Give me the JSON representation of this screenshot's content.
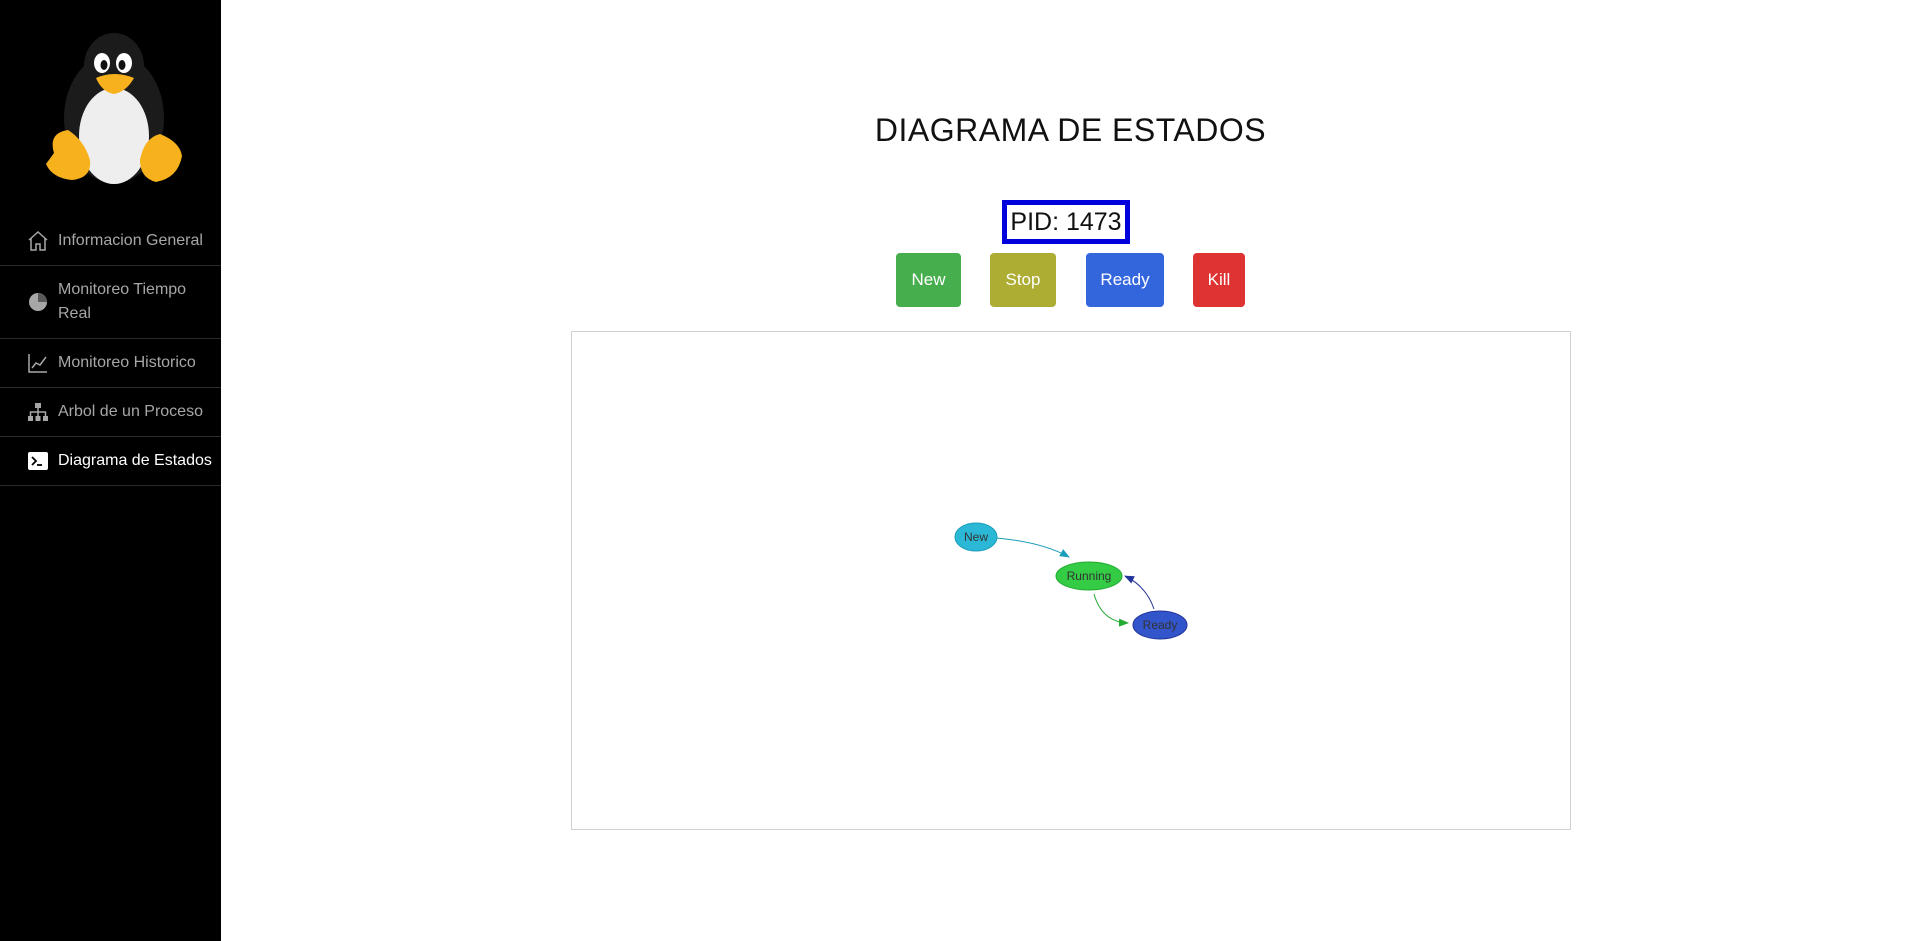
{
  "sidebar": {
    "logo": "tux-penguin-logo",
    "items": [
      {
        "label": "Informacion General",
        "icon": "home-icon",
        "active": false
      },
      {
        "label": "Monitoreo Tiempo Real",
        "icon": "pie-chart-icon",
        "active": false
      },
      {
        "label": "Monitoreo Historico",
        "icon": "line-chart-icon",
        "active": false
      },
      {
        "label": "Arbol de un Proceso",
        "icon": "sitemap-icon",
        "active": false
      },
      {
        "label": "Diagrama de Estados",
        "icon": "terminal-icon",
        "active": true
      }
    ]
  },
  "main": {
    "title": "DIAGRAMA DE ESTADOS",
    "pid_text": "PID: 1473",
    "pid_border_color": "#0000dd",
    "buttons": {
      "new": {
        "label": "New",
        "color": "#47ae4d"
      },
      "stop": {
        "label": "Stop",
        "color": "#acad32"
      },
      "ready": {
        "label": "Ready",
        "color": "#3366dd"
      },
      "kill": {
        "label": "Kill",
        "color": "#dd3333"
      }
    },
    "graph": {
      "nodes": [
        {
          "id": "new",
          "label": "New",
          "color": "#2bb8d6"
        },
        {
          "id": "running",
          "label": "Running",
          "color": "#33cc44"
        },
        {
          "id": "ready",
          "label": "Ready",
          "color": "#3355cc"
        }
      ],
      "edges": [
        {
          "from": "New",
          "to": "Running",
          "color": "#1a9db8"
        },
        {
          "from": "Running",
          "to": "Ready",
          "color": "#22aa33"
        },
        {
          "from": "Ready",
          "to": "Running",
          "color": "#223399"
        }
      ]
    }
  }
}
